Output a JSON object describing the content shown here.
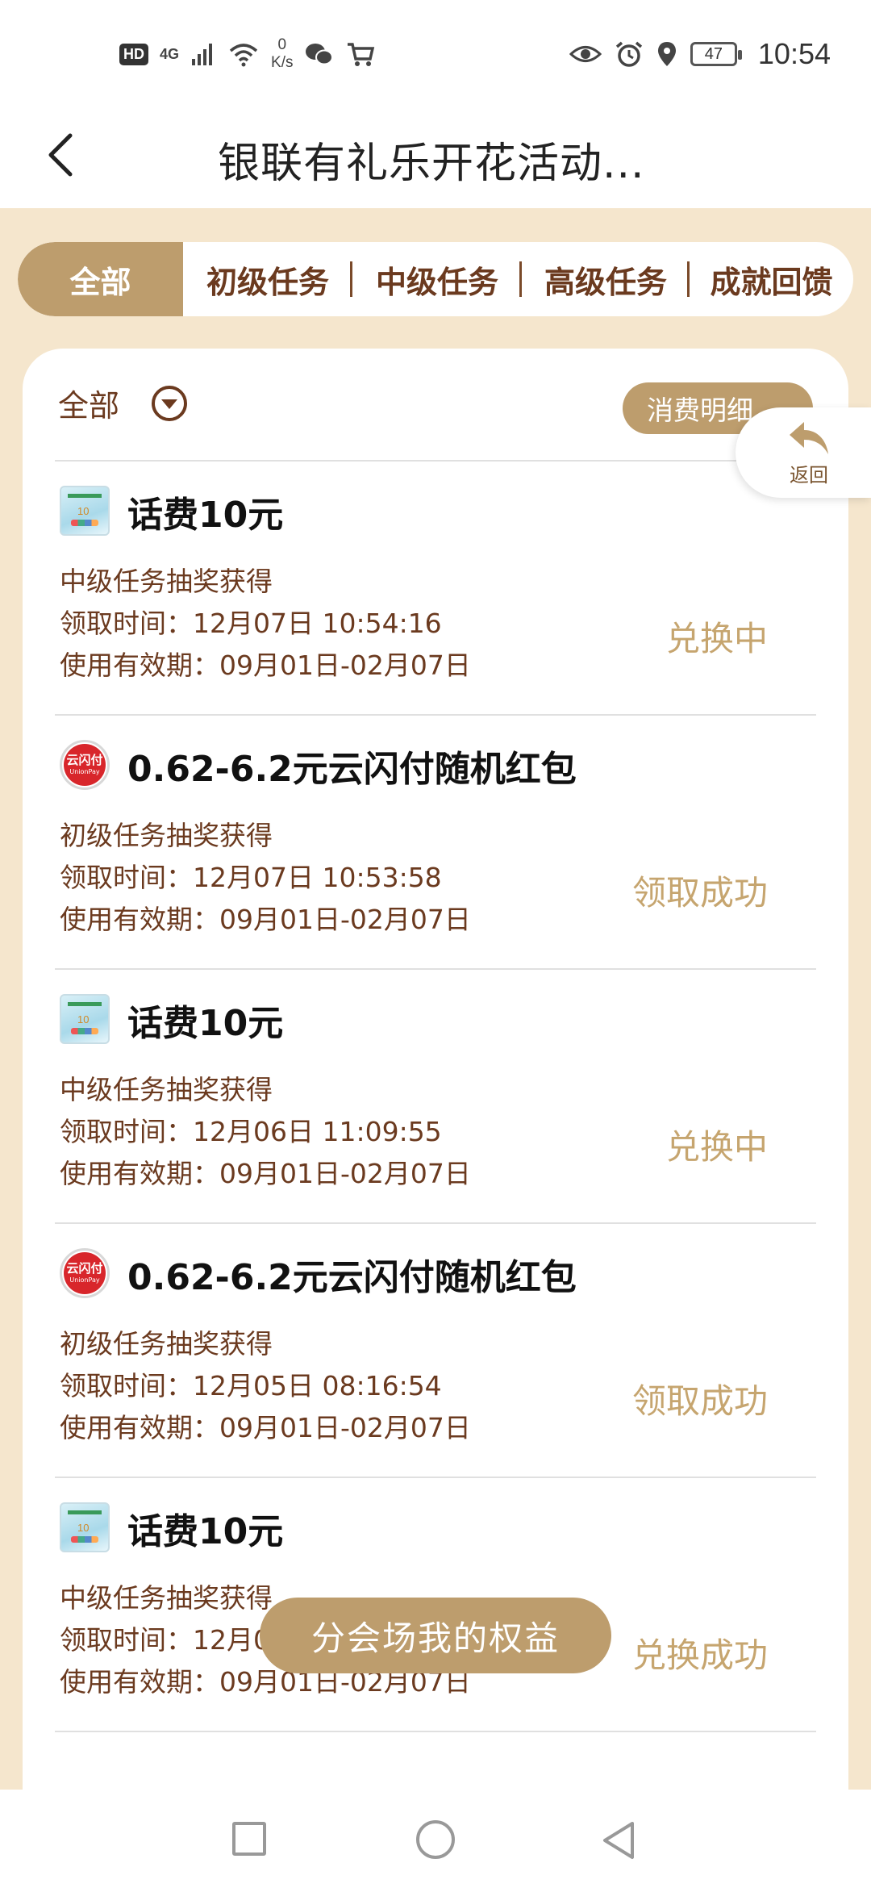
{
  "status_bar": {
    "hd": "HD",
    "net_gen": "4G",
    "speed_value": "0",
    "speed_unit": "K/s",
    "battery": "47",
    "time": "10:54"
  },
  "header": {
    "title": "银联有礼乐开花活动..."
  },
  "tabs": [
    {
      "label": "全部"
    },
    {
      "label": "初级任务"
    },
    {
      "label": "中级任务"
    },
    {
      "label": "高级任务"
    },
    {
      "label": "成就回馈"
    }
  ],
  "filter": {
    "label": "全部",
    "detail_button": "消费明细"
  },
  "float_back": {
    "label": "返回"
  },
  "items": [
    {
      "title": "话费10元",
      "source": "中级任务抽奖获得",
      "time_label": "领取时间：",
      "time": "12月07日 10:54:16",
      "valid_label": "使用有效期：",
      "valid": "09月01日-02月07日",
      "status": "兑换中",
      "icon": "phone-credit-icon"
    },
    {
      "title": "0.62-6.2元云闪付随机红包",
      "source": "初级任务抽奖获得",
      "time_label": "领取时间：",
      "time": "12月07日 10:53:58",
      "valid_label": "使用有效期：",
      "valid": "09月01日-02月07日",
      "status": "领取成功",
      "icon": "unionpay-icon"
    },
    {
      "title": "话费10元",
      "source": "中级任务抽奖获得",
      "time_label": "领取时间：",
      "time": "12月06日 11:09:55",
      "valid_label": "使用有效期：",
      "valid": "09月01日-02月07日",
      "status": "兑换中",
      "icon": "phone-credit-icon"
    },
    {
      "title": "0.62-6.2元云闪付随机红包",
      "source": "初级任务抽奖获得",
      "time_label": "领取时间：",
      "time": "12月05日 08:16:54",
      "valid_label": "使用有效期：",
      "valid": "09月01日-02月07日",
      "status": "领取成功",
      "icon": "unionpay-icon"
    },
    {
      "title": "话费10元",
      "source": "中级任务抽奖获得",
      "time_label": "领取时间：",
      "time": "12月0",
      "valid_label": "使用有效期：",
      "valid": "09月01日-02月07日",
      "status": "兑换成功",
      "icon": "phone-credit-icon"
    }
  ],
  "icon_labels": {
    "ysf_cn": "云闪付",
    "ysf_en": "UnionPay",
    "phone_num": "10"
  },
  "float_button": {
    "label": "分会场我的权益"
  },
  "colors": {
    "accent": "#bd9d6d",
    "background": "#f5e6cd",
    "text_brown": "#6b3a1f",
    "status": "#c6a56f"
  }
}
